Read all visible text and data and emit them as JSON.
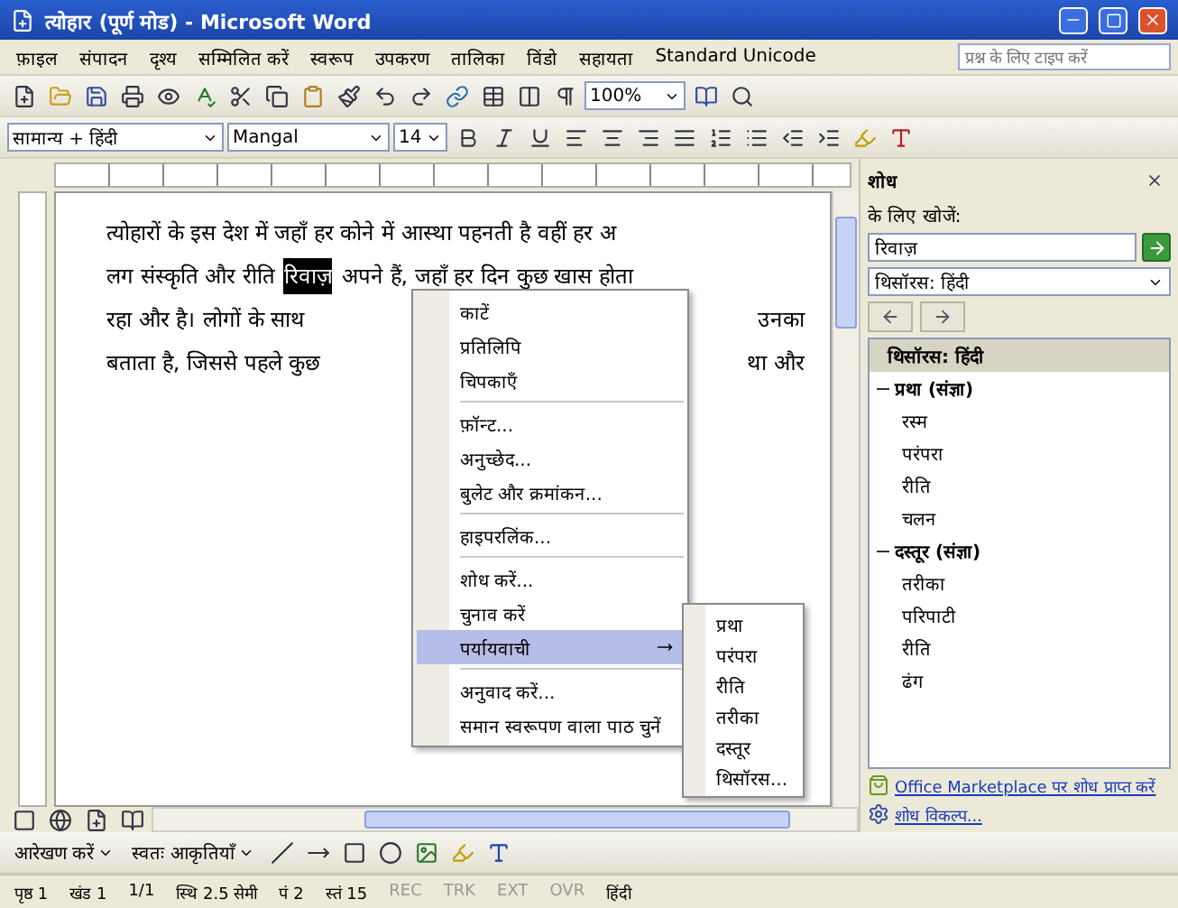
{
  "window": {
    "title": "त्योहार (पूर्ण मोड) - Microsoft Word"
  },
  "menu_bar": {
    "items": [
      "फ़ाइल",
      "संपादन",
      "दृश्य",
      "सम्मिलित करें",
      "स्वरूप",
      "उपकरण",
      "तालिका",
      "विंडो",
      "सहायता",
      "Standard Unicode"
    ],
    "help_placeholder": "प्रश्न के लिए टाइप करें"
  },
  "standard_toolbar": {
    "zoom": "100%"
  },
  "formatting_toolbar": {
    "style": "सामान्य + हिंदी",
    "font": "Mangal",
    "size": "14"
  },
  "document": {
    "lines": [
      {
        "parts": [
          {
            "text": "त्योहारों के इस देश में जहाँ हर कोने में आस्था पहनती है वहीं हर अ",
            "selected": false
          }
        ]
      },
      {
        "parts": [
          {
            "text": "लग संस्कृति और रीति",
            "selected": false
          },
          {
            "text": "रिवाज़",
            "selected": true
          },
          {
            "text": "अपने हैं, जहाँ हर दिन कुछ खास होता",
            "selected": false
          }
        ]
      },
      {
        "parts": [
          {
            "text": "रहा और है। लोगों के साथ",
            "selected": false
          }
        ],
        "right_of_menu": "उनका"
      },
      {
        "parts": [
          {
            "text": "बताता है, जिससे पहले कुछ",
            "selected": false
          }
        ],
        "right_of_menu": "था और"
      }
    ]
  },
  "context_menu": {
    "items": [
      {
        "kind": "item",
        "label": "काटें",
        "selected": false
      },
      {
        "kind": "item",
        "label": "प्रतिलिपि",
        "selected": false
      },
      {
        "kind": "item",
        "label": "चिपकाएँ",
        "selected": false
      },
      {
        "kind": "separator"
      },
      {
        "kind": "item",
        "label": "फ़ॉन्ट...",
        "selected": false
      },
      {
        "kind": "item",
        "label": "अनुच्छेद...",
        "selected": false
      },
      {
        "kind": "item",
        "label": "बुलेट और क्रमांकन...",
        "selected": false
      },
      {
        "kind": "separator"
      },
      {
        "kind": "item",
        "label": "हाइपरलिंक...",
        "selected": false
      },
      {
        "kind": "separator"
      },
      {
        "kind": "item",
        "label": "शोध करें...",
        "selected": false
      },
      {
        "kind": "item",
        "label": "चुनाव करें",
        "selected": false
      },
      {
        "kind": "submenu",
        "label": "पर्यायवाची",
        "selected": true
      },
      {
        "kind": "separator"
      },
      {
        "kind": "item",
        "label": "अनुवाद करें...",
        "selected": false
      },
      {
        "kind": "item",
        "label": "समान स्वरूपण वाला पाठ चुनें",
        "selected": false
      }
    ],
    "submenu": [
      "प्रथा",
      "परंपरा",
      "रीति",
      "तरीका",
      "दस्तूर",
      "थिसॉरस..."
    ]
  },
  "task_pane": {
    "title": "शोध",
    "search_label": "के लिए खोजें:",
    "search_value": "रिवाज़",
    "source": "थिसॉरस: हिंदी",
    "results_header": "थिसॉरस: हिंदी",
    "groups": [
      {
        "label": "प्रथा (संज्ञा)",
        "expanded": true,
        "children": [
          "रस्म",
          "परंपरा",
          "रीति",
          "चलन"
        ]
      },
      {
        "label": "दस्तूर (संज्ञा)",
        "expanded": true,
        "children": [
          "तरीका",
          "परिपाटी",
          "रीति",
          "ढंग"
        ]
      }
    ],
    "links": [
      "Office Marketplace पर शोध प्राप्त करें",
      "शोध विकल्प..."
    ]
  },
  "drawing_toolbar": {
    "draw": "आरेखण करें",
    "autoshapes": "स्वतः आकृतियाँ"
  },
  "status_bar": [
    "पृष्ठ 1",
    "खंड 1",
    "1/1",
    "स्थि 2.5 सेमी",
    "पं 2",
    "स्तं 15",
    "REC",
    "TRK",
    "EXT",
    "OVR",
    "हिंदी"
  ]
}
